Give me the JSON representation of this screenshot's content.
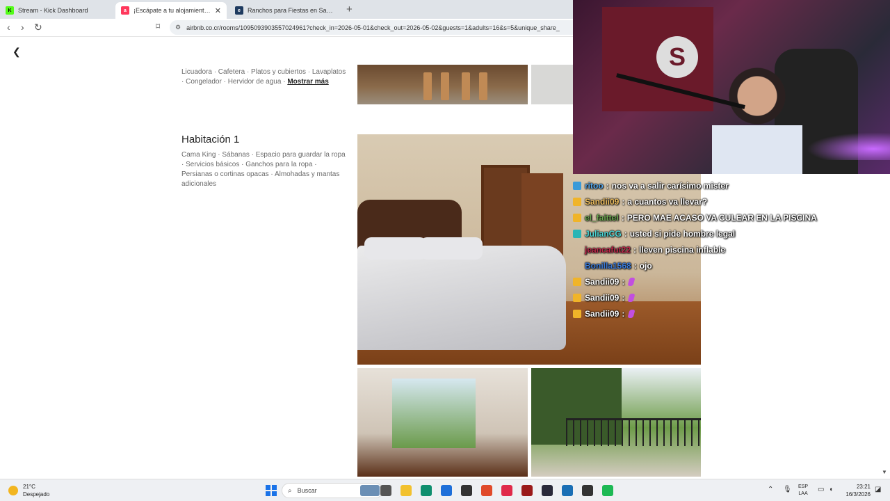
{
  "browser": {
    "tabs": [
      {
        "title": "Stream - Kick Dashboard",
        "favicon_color": "#53fc18"
      },
      {
        "title": "¡Escápate a tu alojamiento de m",
        "favicon_color": "#ff385c"
      },
      {
        "title": "Ranchos para Fiestas en San José - F",
        "favicon_color": "#1e3a5f"
      }
    ],
    "url": "airbnb.co.cr/rooms/1095093903557024961?check_in=2026-05-01&check_out=2026-05-02&guests=1&adults=16&s=5&unique_share_"
  },
  "listing": {
    "kitchen_amenities": "Licuadora · Cafetera · Platos y cubiertos · Lavaplatos · Congelador · Hervidor de agua ·",
    "show_more": "Mostrar más",
    "room_title": "Habitación 1",
    "room_amenities": "Cama King · Sábanas · Espacio para guardar la ropa · Servicios básicos · Ganchos para la ropa · Persianas o cortinas opacas · Almohadas y mantas adicionales"
  },
  "chat": {
    "messages": [
      {
        "user": "ritoo",
        "text": "nos va a salir carísimo mister",
        "user_color": "#53a8f0",
        "badge_color": "#3a9ad9",
        "emote": false
      },
      {
        "user": "Sandii09",
        "text": "a cuantos va llevar?",
        "user_color": "#f0c060",
        "badge_color": "#f0b429",
        "emote": false
      },
      {
        "user": "el_faittel",
        "text": "PERO MAE ACASO VA CULEAR EN LA PISCINA",
        "user_color": "#6aa84f",
        "badge_color": "#f0b429",
        "emote": false
      },
      {
        "user": "JulianCG",
        "text": "usted si pide hombre legal",
        "user_color": "#4ad9d9",
        "badge_color": "#2ab5b5",
        "emote": false
      },
      {
        "user": "jeancafut22",
        "text": "lleven piscina inflable",
        "user_color": "#c0264a",
        "badge_color": "transparent",
        "emote": false
      },
      {
        "user": "Bonilla1568",
        "text": "ojo",
        "user_color": "#3a7ad9",
        "badge_color": "transparent",
        "emote": false
      },
      {
        "user": "Sandii09",
        "text": "",
        "user_color": "#ffffff",
        "badge_color": "#f0b429",
        "emote": true
      },
      {
        "user": "Sandii09",
        "text": "",
        "user_color": "#ffffff",
        "badge_color": "#f0b429",
        "emote": true
      },
      {
        "user": "Sandii09",
        "text": "",
        "user_color": "#ffffff",
        "badge_color": "#f0b429",
        "emote": true
      }
    ]
  },
  "taskbar": {
    "weather_temp": "21°C",
    "weather_desc": "Despejado",
    "search_placeholder": "Buscar",
    "lang_line1": "ESP",
    "lang_line2": "LAA",
    "time": "23:21",
    "date": "16/3/2026",
    "app_icons": [
      "#6b8fb5",
      "#555555",
      "#f2c12e",
      "#0f8f6f",
      "#1e6fd9",
      "#333333",
      "#e04a2a",
      "#e02a4a",
      "#9a1a1a",
      "#2a2a3a",
      "#1a6fb5",
      "#333333",
      "#1db954"
    ]
  }
}
